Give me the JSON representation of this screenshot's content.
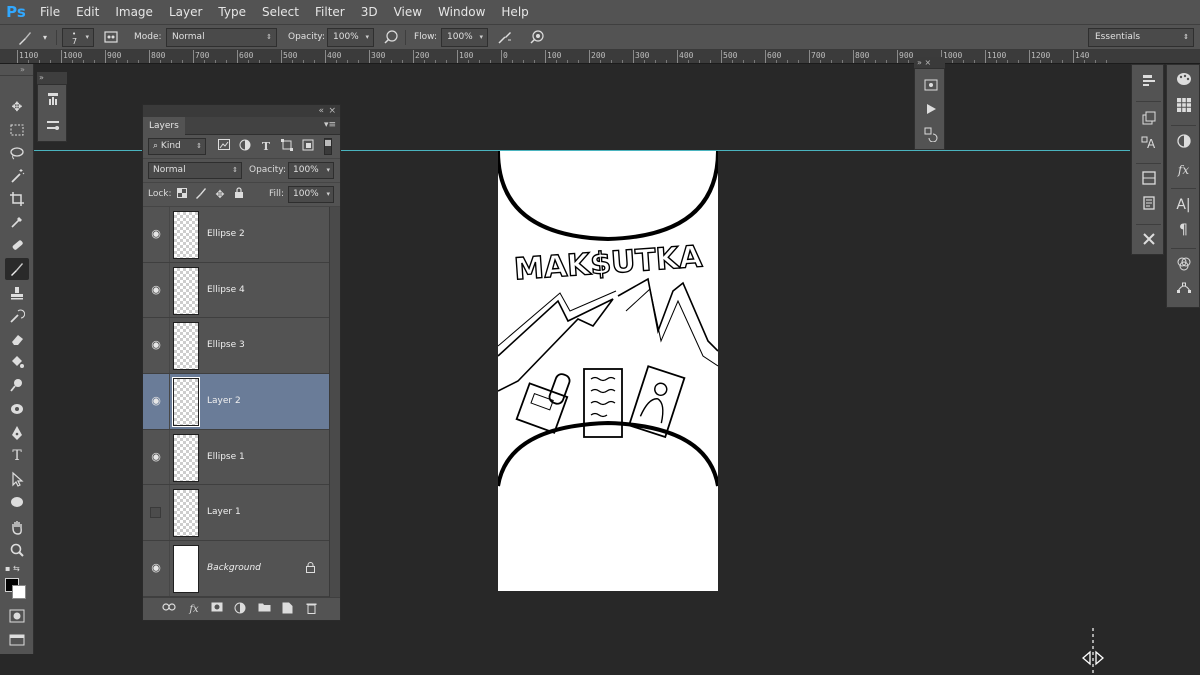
{
  "app": {
    "logo": "Ps"
  },
  "menu": [
    "File",
    "Edit",
    "Image",
    "Layer",
    "Type",
    "Select",
    "Filter",
    "3D",
    "View",
    "Window",
    "Help"
  ],
  "options_bar": {
    "brush_size": "7",
    "mode_label": "Mode:",
    "mode_value": "Normal",
    "opacity_label": "Opacity:",
    "opacity_value": "100%",
    "flow_label": "Flow:",
    "flow_value": "100%",
    "workspace": "Essentials"
  },
  "ruler": {
    "labels": [
      "1100",
      "1000",
      "900",
      "800",
      "700",
      "600",
      "500",
      "400",
      "300",
      "200",
      "100",
      "0",
      "100",
      "200",
      "300",
      "400",
      "500",
      "600",
      "700",
      "800",
      "900",
      "1000",
      "1100",
      "1200",
      "140"
    ]
  },
  "layers_panel": {
    "tab": "Layers",
    "filter_kind": "Kind",
    "blend_mode": "Normal",
    "opacity_label": "Opacity:",
    "opacity_value": "100%",
    "lock_label": "Lock:",
    "fill_label": "Fill:",
    "fill_value": "100%",
    "layers": [
      {
        "name": "Ellipse 2",
        "visible": true,
        "selected": false,
        "thumb": "checker",
        "italic": false,
        "locked": false
      },
      {
        "name": "Ellipse 4",
        "visible": true,
        "selected": false,
        "thumb": "checker",
        "italic": false,
        "locked": false
      },
      {
        "name": "Ellipse 3",
        "visible": true,
        "selected": false,
        "thumb": "checker",
        "italic": false,
        "locked": false
      },
      {
        "name": "Layer 2",
        "visible": true,
        "selected": true,
        "thumb": "checker",
        "italic": false,
        "locked": false
      },
      {
        "name": "Ellipse 1",
        "visible": true,
        "selected": false,
        "thumb": "checker",
        "italic": false,
        "locked": false
      },
      {
        "name": "Layer 1",
        "visible": false,
        "selected": false,
        "thumb": "checker",
        "italic": false,
        "locked": false
      },
      {
        "name": "Background",
        "visible": true,
        "selected": false,
        "thumb": "white",
        "italic": true,
        "locked": true
      }
    ]
  },
  "canvas": {
    "artwork_text": "MAK$UTKA"
  },
  "colors": {
    "accent": "#31a8ff",
    "guide": "#4ec3cf",
    "selected_layer": "#6a7c98",
    "panel": "#535353",
    "workspace_bg": "#282828"
  }
}
